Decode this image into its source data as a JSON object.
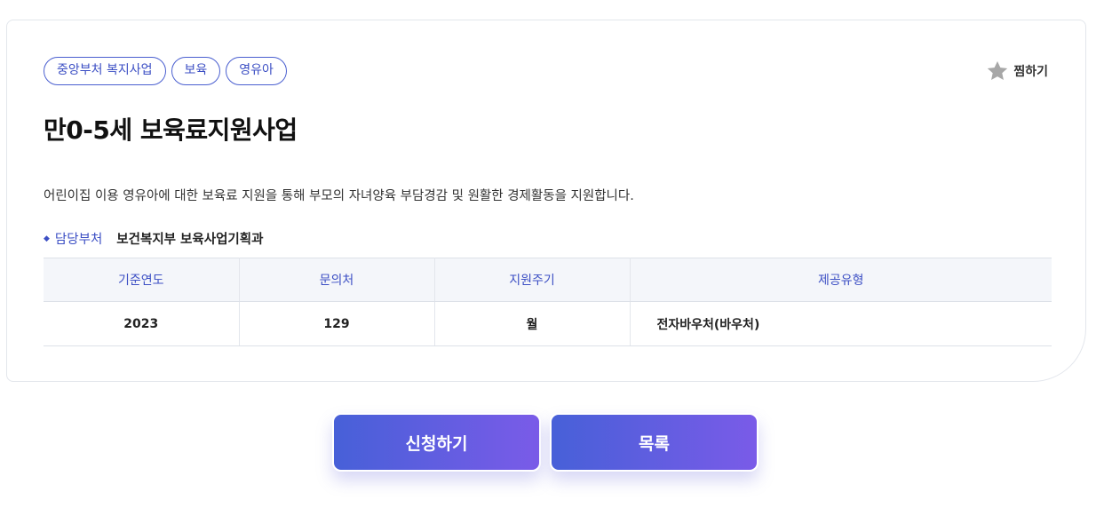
{
  "tags": [
    "중앙부처 복지사업",
    "보육",
    "영유아"
  ],
  "favorite": {
    "label": "찜하기",
    "icon": "star-icon"
  },
  "title": "만0-5세 보육료지원사업",
  "description": "어린이집 이용 영유아에 대한 보육료 지원을 통해 부모의 자녀양육 부담경감 및 원활한 경제활동을 지원합니다.",
  "department": {
    "label": "담당부처",
    "value": "보건복지부 보육사업기획과"
  },
  "table": {
    "headers": [
      "기준연도",
      "문의처",
      "지원주기",
      "제공유형"
    ],
    "row": [
      "2023",
      "129",
      "월",
      "전자바우처(바우처)"
    ]
  },
  "buttons": {
    "apply": "신청하기",
    "list": "목록"
  },
  "colors": {
    "accent": "#3c4fc4",
    "gradient_start": "#4760d8",
    "gradient_end": "#7a5be8"
  }
}
